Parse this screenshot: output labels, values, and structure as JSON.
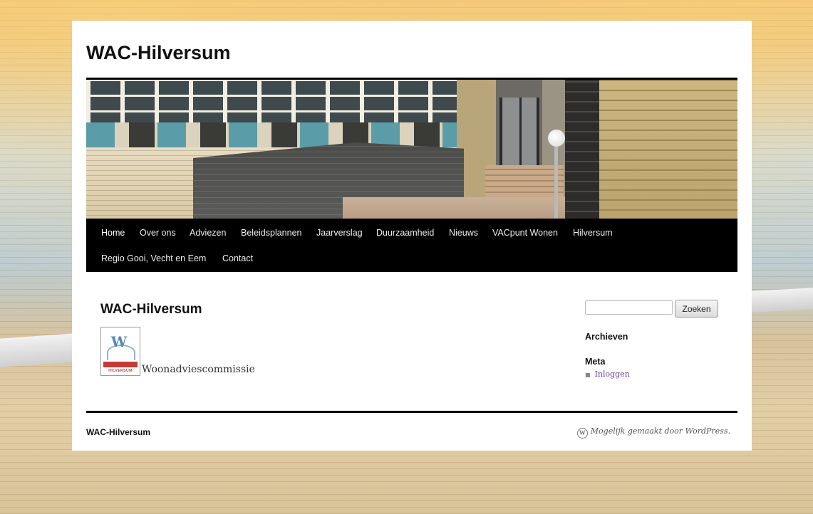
{
  "site": {
    "title": "WAC-Hilversum"
  },
  "nav": {
    "items": [
      {
        "label": "Home",
        "active": true
      },
      {
        "label": "Over ons"
      },
      {
        "label": "Adviezen"
      },
      {
        "label": "Beleidsplannen"
      },
      {
        "label": "Jaarverslag"
      },
      {
        "label": "Duurzaamheid"
      },
      {
        "label": "Nieuws"
      },
      {
        "label": "VACpunt Wonen"
      },
      {
        "label": "Hilversum"
      },
      {
        "label": "Regio Gooi, Vecht en Eem"
      },
      {
        "label": "Contact"
      }
    ]
  },
  "post": {
    "title": "WAC-Hilversum",
    "logo_text": "HILVERSUM",
    "caption": "Woonadviescommissie"
  },
  "sidebar": {
    "search": {
      "value": "",
      "button_label": "Zoeken"
    },
    "archives_title": "Archieven",
    "meta_title": "Meta",
    "meta_links": [
      "Inloggen"
    ]
  },
  "footer": {
    "site_name": "WAC-Hilversum",
    "credit": "Mogelijk gemaakt door WordPress."
  },
  "colors": {
    "nav_background": "#000000",
    "link_purple": "#6b3fa0"
  },
  "icons": {
    "wordpress": "wordpress-icon"
  }
}
